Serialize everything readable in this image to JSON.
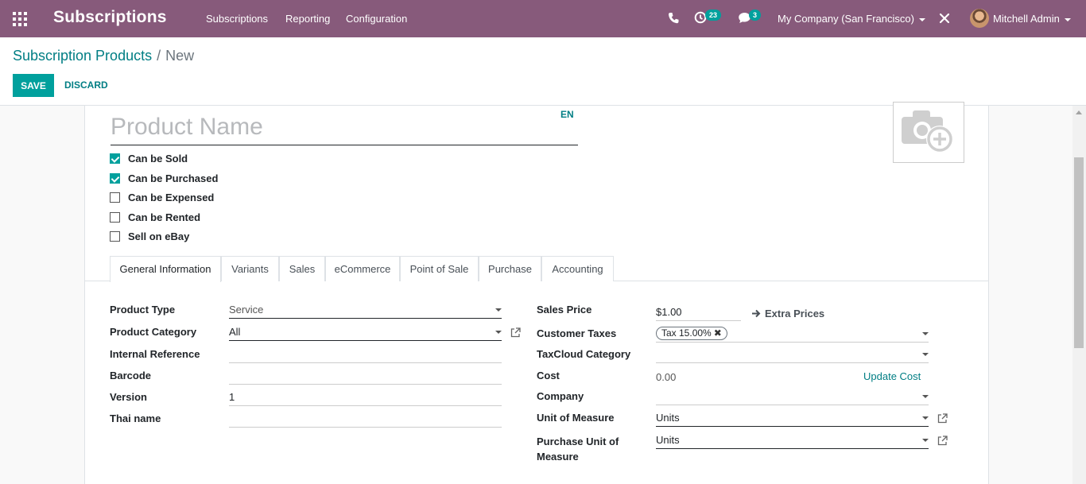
{
  "navbar": {
    "app_title": "Subscriptions",
    "menu": [
      "Subscriptions",
      "Reporting",
      "Configuration"
    ],
    "activity_count": "23",
    "message_count": "3",
    "company": "My Company (San Francisco)",
    "user": "Mitchell Admin",
    "color": "#875A7B"
  },
  "breadcrumb": {
    "parent": "Subscription Products",
    "separator": "/",
    "current": "New"
  },
  "buttons": {
    "save": "SAVE",
    "discard": "DISCARD"
  },
  "form": {
    "name_placeholder": "Product Name",
    "lang": "EN",
    "checkboxes": [
      {
        "label": "Can be Sold",
        "checked": true
      },
      {
        "label": "Can be Purchased",
        "checked": true
      },
      {
        "label": "Can be Expensed",
        "checked": false
      },
      {
        "label": "Can be Rented",
        "checked": false
      },
      {
        "label": "Sell on eBay",
        "checked": false
      }
    ],
    "tabs": [
      "General Information",
      "Variants",
      "Sales",
      "eCommerce",
      "Point of Sale",
      "Purchase",
      "Accounting"
    ],
    "active_tab": "General Information",
    "left": {
      "product_type": {
        "label": "Product Type",
        "value": "Service"
      },
      "product_category": {
        "label": "Product Category",
        "value": "All"
      },
      "internal_reference": {
        "label": "Internal Reference",
        "value": ""
      },
      "barcode": {
        "label": "Barcode",
        "value": ""
      },
      "version": {
        "label": "Version",
        "value": "1"
      },
      "thai_name": {
        "label": "Thai name",
        "value": ""
      }
    },
    "right": {
      "sales_price": {
        "label": "Sales Price",
        "value": "$1.00"
      },
      "extra_prices": "Extra Prices",
      "customer_taxes": {
        "label": "Customer Taxes",
        "tag": "Tax 15.00%"
      },
      "taxcloud_category": {
        "label": "TaxCloud Category",
        "value": ""
      },
      "cost": {
        "label": "Cost",
        "value": "0.00"
      },
      "update_cost": "Update Cost",
      "company": {
        "label": "Company",
        "value": ""
      },
      "uom": {
        "label": "Unit of Measure",
        "value": "Units"
      },
      "purchase_uom": {
        "label_line1": "Purchase Unit of",
        "label_line2": "Measure",
        "value": "Units"
      }
    }
  },
  "colors": {
    "primary": "#00A09D",
    "link": "#017e84"
  }
}
